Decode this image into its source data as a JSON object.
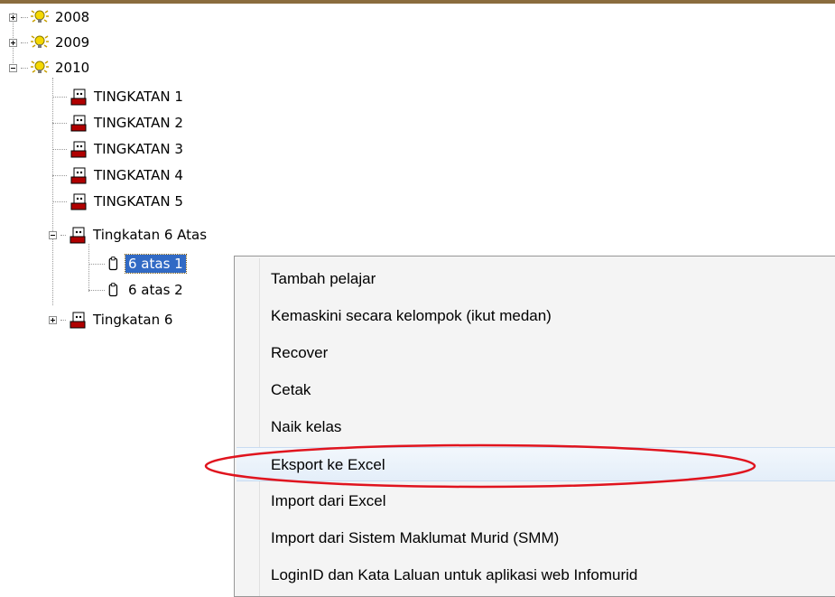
{
  "tree": {
    "years": [
      {
        "label": "2008",
        "expanded": false
      },
      {
        "label": "2009",
        "expanded": false
      },
      {
        "label": "2010",
        "expanded": true
      }
    ],
    "forms": [
      "TINGKATAN 1",
      "TINGKATAN 2",
      "TINGKATAN 3",
      "TINGKATAN 4",
      "TINGKATAN 5"
    ],
    "form6_upper": {
      "label": "Tingkatan 6 Atas",
      "expanded": true,
      "classes": [
        {
          "label": "6 atas 1",
          "selected": true
        },
        {
          "label": "6 atas 2",
          "selected": false
        }
      ]
    },
    "form6_lower": {
      "label": "Tingkatan 6",
      "expanded": false
    }
  },
  "context_menu": {
    "items": [
      "Tambah pelajar",
      "Kemaskini secara kelompok (ikut medan)",
      "Recover",
      "Cetak",
      "Naik kelas",
      "Eksport ke Excel",
      "Import dari Excel",
      "Import dari Sistem Maklumat Murid (SMM)",
      "LoginID dan Kata Laluan untuk aplikasi web Infomurid"
    ],
    "highlighted": "Eksport ke Excel"
  },
  "colors": {
    "selection": "#316ac5",
    "annotation": "#e0141e",
    "menu_bg": "#f4f4f4"
  }
}
